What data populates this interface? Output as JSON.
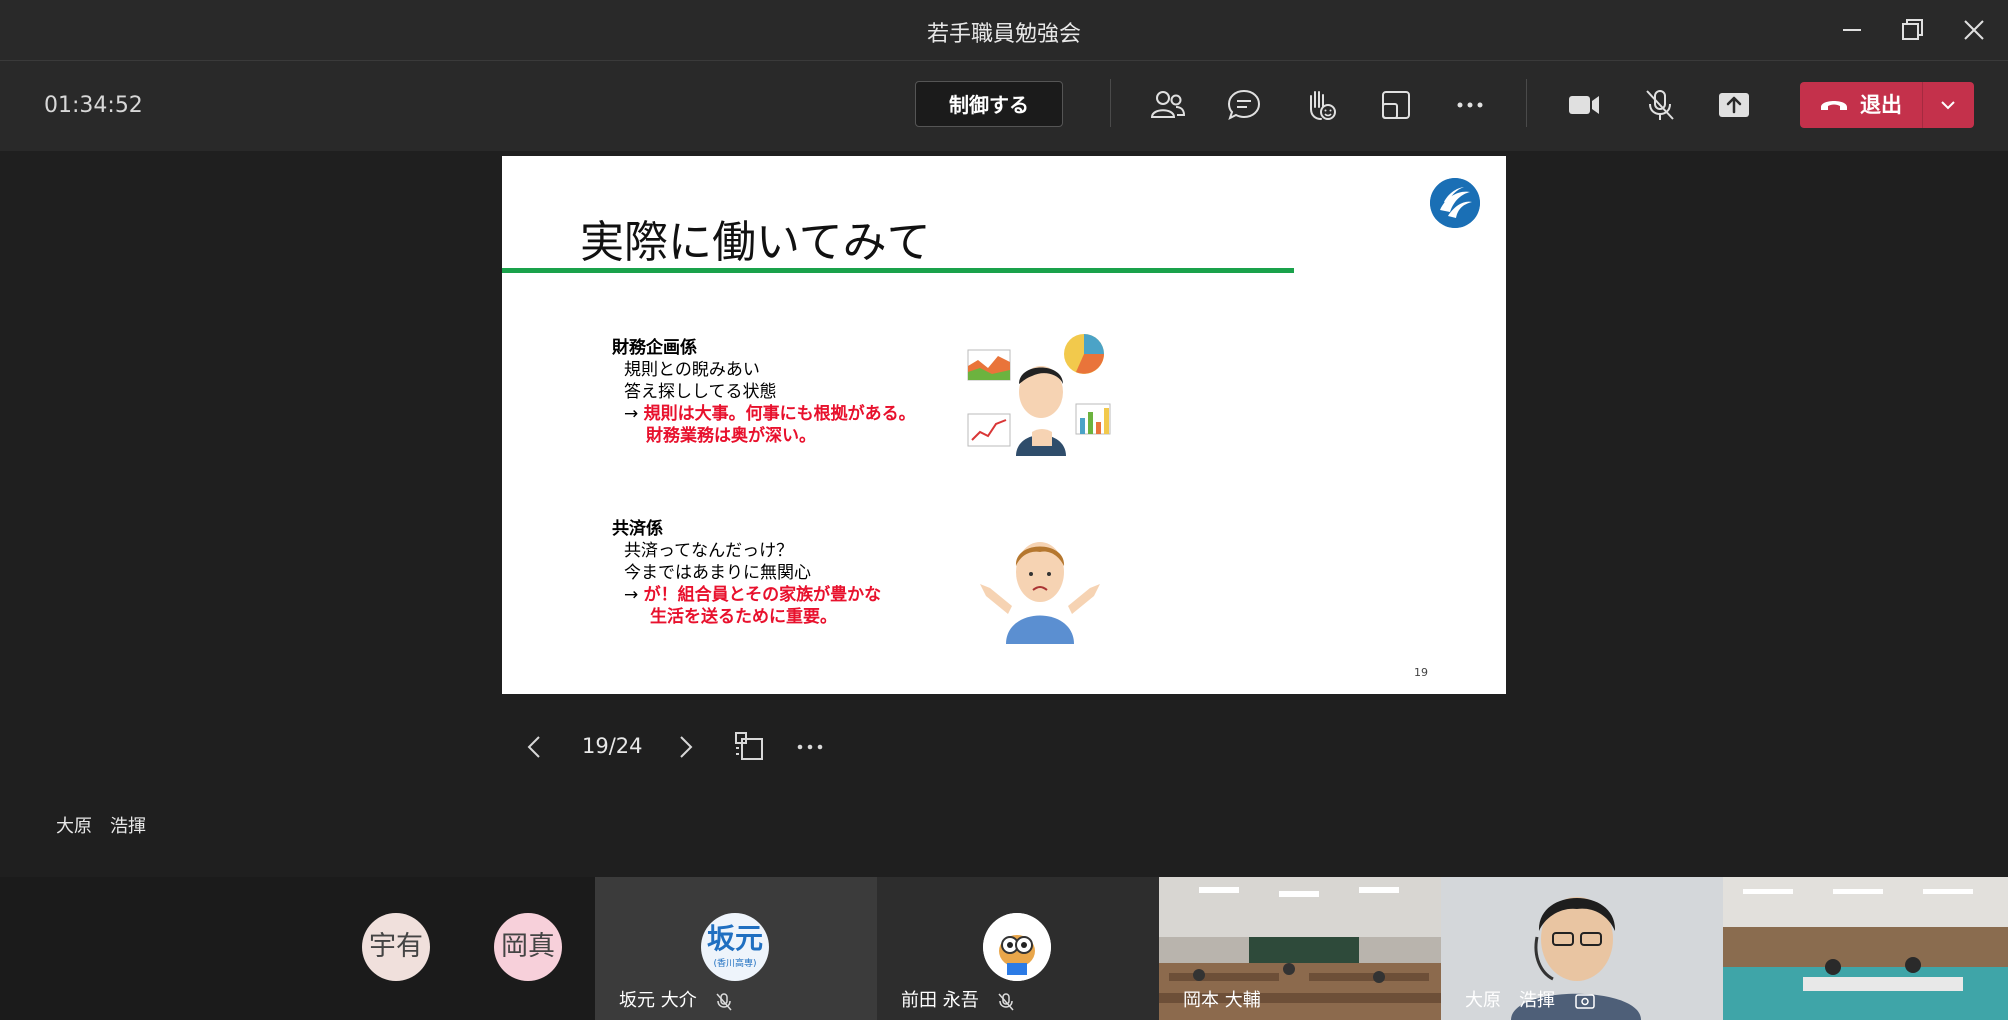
{
  "window": {
    "title": "若手職員勉強会"
  },
  "toolbar": {
    "timer": "01:34:52",
    "control_label": "制御する",
    "leave_label": "退出"
  },
  "slide": {
    "title": "実際に働いてみて",
    "section1": {
      "heading": "財務企画係",
      "line1": "規則との睨みあい",
      "line2": "答え探ししてる状態",
      "arrow1": "→",
      "red1": "規則は大事。何事にも根拠がある。",
      "red2": "財務業務は奥が深い。"
    },
    "section2": {
      "heading": "共済係",
      "line1": "共済ってなんだっけ？",
      "line2": "今まではあまりに無関心",
      "arrow1": "→",
      "red1": "が！組合員とその家族が豊かな",
      "red2": "生活を送るために重要。"
    },
    "page_number": "19"
  },
  "slide_nav": {
    "counter": "19/24"
  },
  "presenter": {
    "name": "大原　浩揮"
  },
  "participants": [
    {
      "initials": "宇有",
      "color": "#f0e0dc"
    },
    {
      "initials": "岡真",
      "color": "#f7d0da"
    },
    {
      "name": "坂元 大介",
      "avatar_text": "坂元",
      "avatar_sub": "(香川高専)"
    },
    {
      "name": "前田 永吾"
    },
    {
      "name": "岡本 大輔"
    },
    {
      "name": "大原　浩揮"
    }
  ]
}
